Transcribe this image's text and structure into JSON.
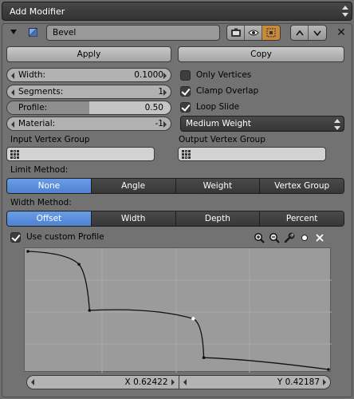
{
  "add_modifier": {
    "label": "Add Modifier"
  },
  "modifier": {
    "name": "Bevel",
    "apply_label": "Apply",
    "copy_label": "Copy"
  },
  "fields": {
    "width": {
      "label": "Width:",
      "value": "0.1000"
    },
    "segments": {
      "label": "Segments:",
      "value": "1"
    },
    "profile": {
      "label": "Profile:",
      "value": "0.50",
      "fill_fraction": 0.5
    },
    "material": {
      "label": "Material:",
      "value": "-1"
    }
  },
  "checkboxes": {
    "only_vertices": {
      "label": "Only Vertices",
      "checked": false
    },
    "clamp_overlap": {
      "label": "Clamp Overlap",
      "checked": true
    },
    "loop_slide": {
      "label": "Loop Slide",
      "checked": true
    },
    "use_custom_profile": {
      "label": "Use custom Profile",
      "checked": true
    }
  },
  "weight_select": {
    "value": "Medium Weight"
  },
  "vertex_groups": {
    "input_label": "Input Vertex Group",
    "output_label": "Output Vertex Group"
  },
  "limit_method": {
    "label": "Limit Method:",
    "options": [
      "None",
      "Angle",
      "Weight",
      "Vertex Group"
    ],
    "active": "None"
  },
  "width_method": {
    "label": "Width Method:",
    "options": [
      "Offset",
      "Width",
      "Depth",
      "Percent"
    ],
    "active": "Offset"
  },
  "curve": {
    "selected_x": "X 0.62422",
    "selected_y": "Y 0.42187",
    "points": [
      [
        0.0,
        1.0
      ],
      [
        0.17,
        0.89
      ],
      [
        0.205,
        0.5
      ],
      [
        0.55,
        0.43
      ],
      [
        0.585,
        0.1
      ],
      [
        1.0,
        0.0
      ]
    ]
  },
  "colors": {
    "accent_blue": "#5a8ddb",
    "panel_bg": "#727272"
  }
}
